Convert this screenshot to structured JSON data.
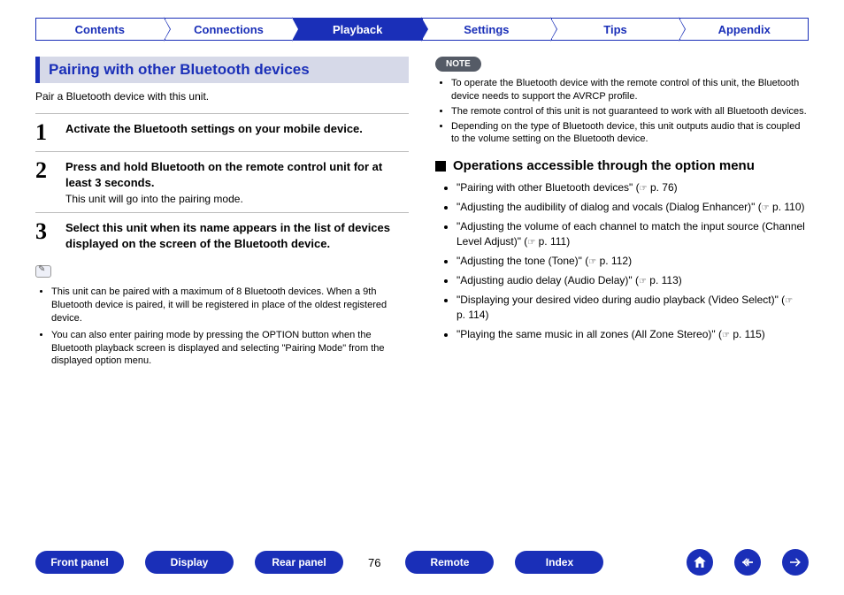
{
  "tabs": [
    "Contents",
    "Connections",
    "Playback",
    "Settings",
    "Tips",
    "Appendix"
  ],
  "active_tab_index": 2,
  "left": {
    "section_title": "Pairing with other Bluetooth devices",
    "intro": "Pair a Bluetooth device with this unit.",
    "steps": [
      {
        "num": "1",
        "title": "Activate the Bluetooth settings on your mobile device.",
        "desc": ""
      },
      {
        "num": "2",
        "title": "Press and hold Bluetooth on the remote control unit for at least 3 seconds.",
        "desc": "This unit will go into the pairing mode."
      },
      {
        "num": "3",
        "title": "Select this unit when its name appears in the list of devices displayed on the screen of the Bluetooth device.",
        "desc": ""
      }
    ],
    "tips": [
      "This unit can be paired with a maximum of 8 Bluetooth devices. When a 9th Bluetooth device is paired, it will be registered in place of the oldest registered device.",
      "You can also enter pairing mode by pressing the OPTION button when the Bluetooth playback screen is displayed and selecting \"Pairing Mode\" from the displayed option menu."
    ]
  },
  "right": {
    "note_label": "NOTE",
    "notes": [
      "To operate the Bluetooth device with the remote control of this unit, the Bluetooth device needs to support the AVRCP profile.",
      "The remote control of this unit is not guaranteed to work with all Bluetooth devices.",
      "Depending on the type of Bluetooth device, this unit outputs audio that is coupled to the volume setting on the Bluetooth device."
    ],
    "subheader": "Operations accessible through the option menu",
    "options": [
      {
        "text": "\"Pairing with other Bluetooth devices\"",
        "page": "p. 76"
      },
      {
        "text": "\"Adjusting the audibility of dialog and vocals (Dialog Enhancer)\"",
        "page": "p. 110"
      },
      {
        "text": "\"Adjusting the volume of each channel to match the input source (Channel Level Adjust)\"",
        "page": "p. 111"
      },
      {
        "text": "\"Adjusting the tone (Tone)\"",
        "page": "p. 112"
      },
      {
        "text": "\"Adjusting audio delay (Audio Delay)\"",
        "page": "p. 113"
      },
      {
        "text": "\"Displaying your desired video during audio playback (Video Select)\"",
        "page": "p. 114"
      },
      {
        "text": "\"Playing the same music in all zones (All Zone Stereo)\"",
        "page": "p. 115"
      }
    ]
  },
  "footer": {
    "pills": [
      "Front panel",
      "Display",
      "Rear panel"
    ],
    "page_number": "76",
    "pills_right": [
      "Remote",
      "Index"
    ]
  }
}
